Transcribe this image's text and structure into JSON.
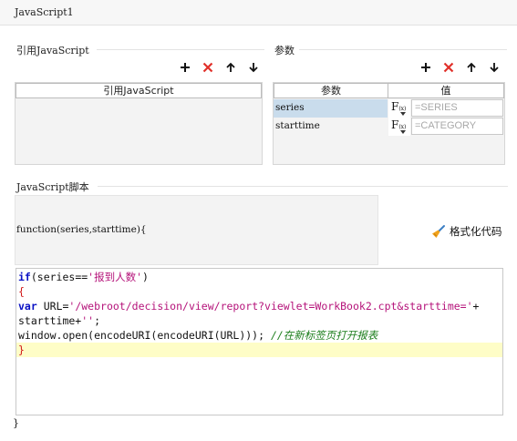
{
  "window": {
    "title": "JavaScript1"
  },
  "references": {
    "label": "引用JavaScript",
    "column_header": "引用JavaScript",
    "rows": []
  },
  "params": {
    "label": "参数",
    "col_name": "参数",
    "col_value": "值",
    "rows": [
      {
        "name": "series",
        "value": "=SERIES",
        "selected": true
      },
      {
        "name": "starttime",
        "value": "=CATEGORY",
        "selected": false
      }
    ]
  },
  "toolbar_icons": [
    "plus-icon",
    "delete-icon",
    "arrow-up-icon",
    "arrow-down-icon"
  ],
  "script": {
    "label": "JavaScript脚本",
    "signature": "function(series,starttime){",
    "format_button": "格式化代码",
    "code": {
      "l1_kw": "if",
      "l1_a": "(series==",
      "l1_str": "'报到人数'",
      "l1_b": ")",
      "l2": "{",
      "l3_kw": "var",
      "l3_a": " URL=",
      "l3_str": "'/webroot/decision/view/report?viewlet=WorkBook2.cpt&starttime='",
      "l3_b": "+",
      "l4_a": "starttime+",
      "l4_str": "''",
      "l4_b": ";",
      "l5_a": "window.open(encodeURI(encodeURI(URL))); ",
      "l5_cmt": "//在新标签页打开报表",
      "l6": "}"
    },
    "closing": "}"
  },
  "colors": {
    "keyword": "#0a11c4",
    "string": "#b5137a",
    "brace": "#d01616",
    "comment": "#1b7d1b",
    "current_line": "#fefdc7",
    "selected_row": "#c9dcec",
    "delete_icon": "#e0302a"
  }
}
